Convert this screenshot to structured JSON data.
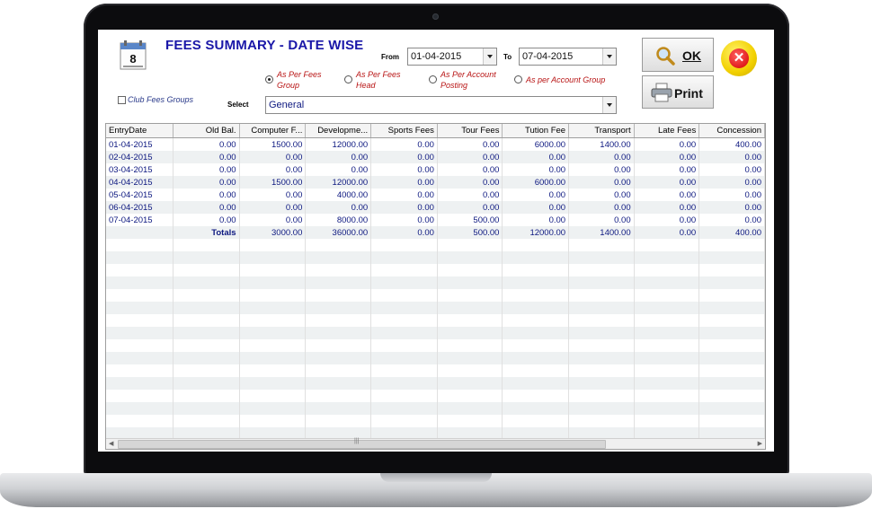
{
  "window": {
    "title": "FEES SUMMARY - DATE WISE",
    "calendar_day": "8"
  },
  "filters": {
    "from_label": "From",
    "from_value": "01-04-2015",
    "to_label": "To",
    "to_value": "07-04-2015",
    "select_label": "Select",
    "select_value": "General",
    "club_label": "Club Fees Groups",
    "options": [
      {
        "label": "As Per Fees Group",
        "selected": true
      },
      {
        "label": "As Per Fees Head",
        "selected": false
      },
      {
        "label": "As Per Account Posting",
        "selected": false
      },
      {
        "label": "As per Account Group",
        "selected": false
      }
    ]
  },
  "buttons": {
    "ok": "OK",
    "print": "Print",
    "close": "✕"
  },
  "grid": {
    "columns": [
      "EntryDate",
      "Old Bal.",
      "Computer F...",
      "Developme...",
      "Sports Fees",
      "Tour Fees",
      "Tution Fee",
      "Transport",
      "Late Fees",
      "Concession"
    ],
    "rows": [
      [
        "01-04-2015",
        "0.00",
        "1500.00",
        "12000.00",
        "0.00",
        "0.00",
        "6000.00",
        "1400.00",
        "0.00",
        "400.00"
      ],
      [
        "02-04-2015",
        "0.00",
        "0.00",
        "0.00",
        "0.00",
        "0.00",
        "0.00",
        "0.00",
        "0.00",
        "0.00"
      ],
      [
        "03-04-2015",
        "0.00",
        "0.00",
        "0.00",
        "0.00",
        "0.00",
        "0.00",
        "0.00",
        "0.00",
        "0.00"
      ],
      [
        "04-04-2015",
        "0.00",
        "1500.00",
        "12000.00",
        "0.00",
        "0.00",
        "6000.00",
        "0.00",
        "0.00",
        "0.00"
      ],
      [
        "05-04-2015",
        "0.00",
        "0.00",
        "4000.00",
        "0.00",
        "0.00",
        "0.00",
        "0.00",
        "0.00",
        "0.00"
      ],
      [
        "06-04-2015",
        "0.00",
        "0.00",
        "0.00",
        "0.00",
        "0.00",
        "0.00",
        "0.00",
        "0.00",
        "0.00"
      ],
      [
        "07-04-2015",
        "0.00",
        "0.00",
        "8000.00",
        "0.00",
        "500.00",
        "0.00",
        "0.00",
        "0.00",
        "0.00"
      ]
    ],
    "totals": [
      "Totals",
      "3000.00",
      "36000.00",
      "0.00",
      "500.00",
      "12000.00",
      "1400.00",
      "0.00",
      "400.00"
    ]
  },
  "colors": {
    "title": "#1a17a8",
    "cell_text": "#0d1880",
    "option_text": "#b81414"
  }
}
